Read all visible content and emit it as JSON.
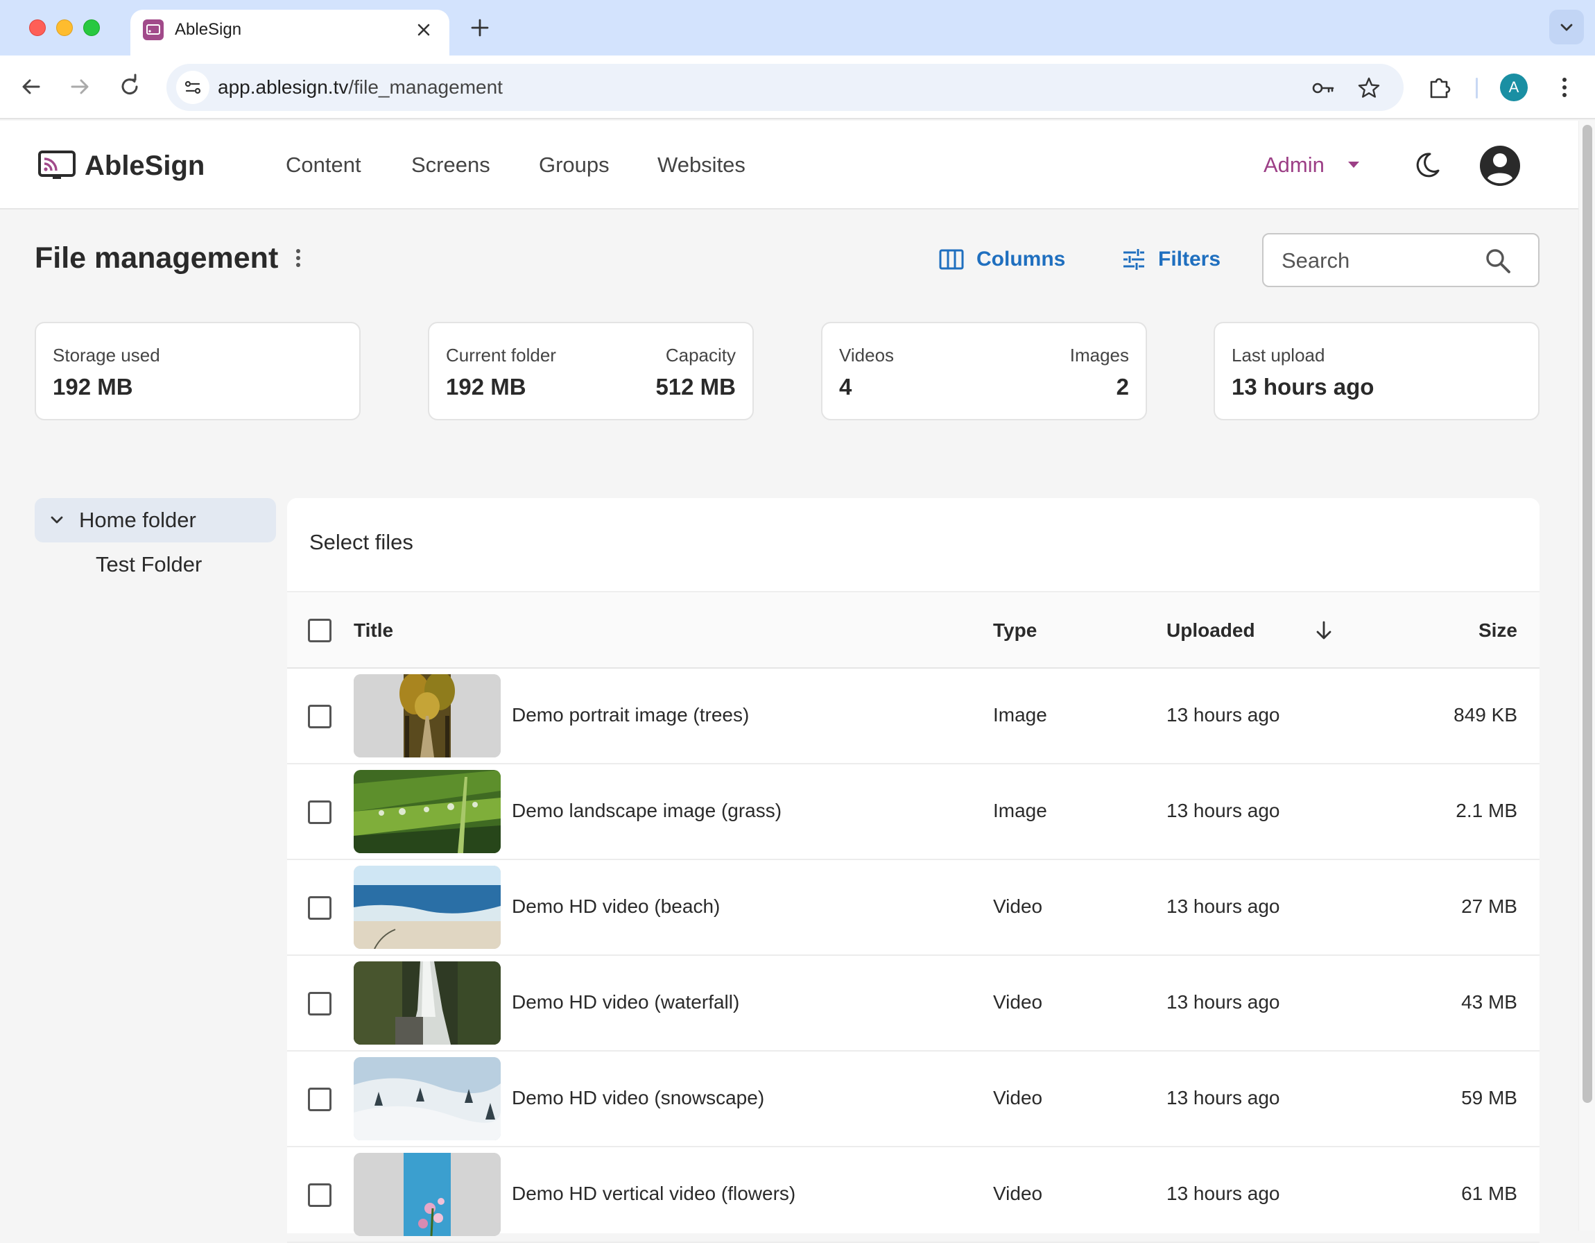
{
  "browser": {
    "tab_title": "AbleSign",
    "url_host": "app.ablesign.tv",
    "url_path": "/file_management",
    "profile_initial": "A"
  },
  "header": {
    "logo_text": "AbleSign",
    "nav": [
      "Content",
      "Screens",
      "Groups",
      "Websites"
    ],
    "role": "Admin"
  },
  "page": {
    "title": "File management",
    "columns_label": "Columns",
    "filters_label": "Filters",
    "search_placeholder": "Search"
  },
  "stats": {
    "storage_label": "Storage used",
    "storage_value": "192 MB",
    "current_folder_label": "Current folder",
    "current_folder_value": "192 MB",
    "capacity_label": "Capacity",
    "capacity_value": "512 MB",
    "videos_label": "Videos",
    "videos_value": "4",
    "images_label": "Images",
    "images_value": "2",
    "last_upload_label": "Last upload",
    "last_upload_value": "13 hours ago"
  },
  "folders": {
    "home": "Home folder",
    "children": [
      "Test Folder"
    ]
  },
  "table": {
    "heading": "Select files",
    "columns": {
      "title": "Title",
      "type": "Type",
      "uploaded": "Uploaded",
      "size": "Size"
    },
    "sort": {
      "column": "uploaded",
      "direction": "descending"
    },
    "rows": [
      {
        "title": "Demo portrait image (trees)",
        "type": "Image",
        "uploaded": "13 hours ago",
        "size": "849 KB",
        "thumb": "trees"
      },
      {
        "title": "Demo landscape image (grass)",
        "type": "Image",
        "uploaded": "13 hours ago",
        "size": "2.1 MB",
        "thumb": "grass"
      },
      {
        "title": "Demo HD video (beach)",
        "type": "Video",
        "uploaded": "13 hours ago",
        "size": "27 MB",
        "thumb": "beach"
      },
      {
        "title": "Demo HD video (waterfall)",
        "type": "Video",
        "uploaded": "13 hours ago",
        "size": "43 MB",
        "thumb": "waterfall"
      },
      {
        "title": "Demo HD video (snowscape)",
        "type": "Video",
        "uploaded": "13 hours ago",
        "size": "59 MB",
        "thumb": "snowscape"
      },
      {
        "title": "Demo HD vertical video (flowers)",
        "type": "Video",
        "uploaded": "13 hours ago",
        "size": "61 MB",
        "thumb": "flowers"
      }
    ]
  },
  "colors": {
    "accent_blue": "#1f6fbf",
    "admin_purple": "#9c3f86"
  }
}
